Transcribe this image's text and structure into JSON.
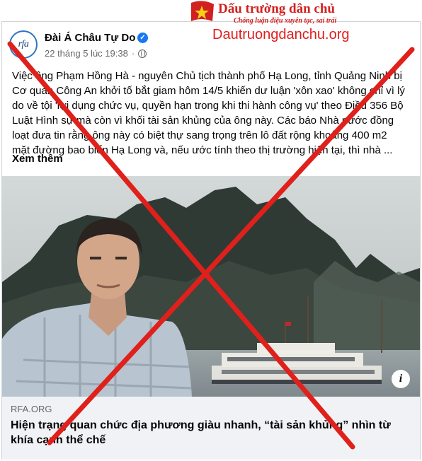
{
  "post": {
    "avatar_text": "rfa",
    "page_name": "Đài Á Châu Tự Do",
    "date": "22 tháng 5 lúc 19:38",
    "separator": "·",
    "body_lines": [
      "Việc ông Phạm Hồng Hà - nguyên Chủ tịch thành phố Hạ Long, tỉnh Quảng Ninh bị",
      "Cơ quan Công An khởi tố bắt giam hôm 14/5 khiến dư luận 'xôn xao' không chỉ vì lý",
      "do về tội 'lợi dụng chức vụ, quyền hạn trong khi thi hành công vụ' theo Điều 356 Bộ",
      "Luật Hình sự mà còn vì khối tài sản khủng của ông này. Các báo Nhà nước đồng",
      "loạt đưa tin rằng ông này có biệt thự sang trọng trên lô đất rộng khoảng 400 m2",
      "mặt đường bao biển Hạ Long và, nếu ước tính theo thị trường hiện tại, thì nhà ..."
    ],
    "see_more": "Xem thêm",
    "info_label": "i",
    "link_domain": "RFA.ORG",
    "link_title": "Hiện trạng quan chức địa phương giàu nhanh, “tài sản khủng” nhìn từ khía cạnh thể chế"
  },
  "watermark": {
    "name": "Dấu trường dân chủ",
    "slogan": "Chống luận điệu xuyên tạc, sai trái",
    "url": "Dautruongdanchu.org"
  },
  "colors": {
    "verified": "#1877f2",
    "cross": "#e0201b",
    "watermark": "#d21f1f"
  }
}
